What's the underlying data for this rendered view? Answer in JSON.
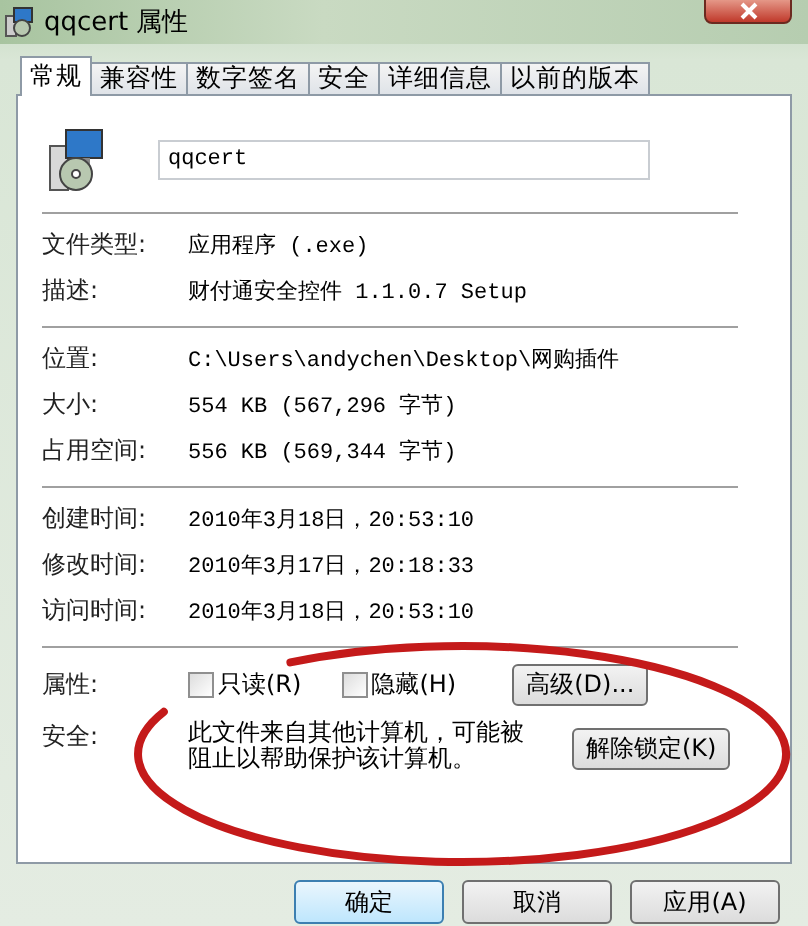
{
  "window": {
    "title": "qqcert 属性"
  },
  "tabs": [
    {
      "label": "常规",
      "selected": true
    },
    {
      "label": "兼容性",
      "selected": false
    },
    {
      "label": "数字签名",
      "selected": false
    },
    {
      "label": "安全",
      "selected": false
    },
    {
      "label": "详细信息",
      "selected": false
    },
    {
      "label": "以前的版本",
      "selected": false
    }
  ],
  "file_name": {
    "value": "qqcert"
  },
  "sections": [
    [
      {
        "label": "文件类型:",
        "value": "应用程序 (.exe)"
      },
      {
        "label": "描述:",
        "value": "财付通安全控件 1.1.0.7 Setup"
      }
    ],
    [
      {
        "label": "位置:",
        "value": "C:\\Users\\andychen\\Desktop\\网购插件"
      },
      {
        "label": "大小:",
        "value": "554 KB (567,296 字节)"
      },
      {
        "label": "占用空间:",
        "value": "556 KB (569,344 字节)"
      }
    ],
    [
      {
        "label": "创建时间:",
        "value": "2010年3月18日，20:53:10"
      },
      {
        "label": "修改时间:",
        "value": "2010年3月17日，20:18:33"
      },
      {
        "label": "访问时间:",
        "value": "2010年3月18日，20:53:10"
      }
    ]
  ],
  "attributes": {
    "label": "属性:",
    "checkboxes": [
      {
        "label": "只读(R)",
        "checked": false
      },
      {
        "label": "隐藏(H)",
        "checked": false
      }
    ],
    "button": "高级(D)..."
  },
  "security": {
    "label": "安全:",
    "text": "此文件来自其他计算机，可能被阻止以帮助保护该计算机。",
    "button": "解除锁定(K)"
  },
  "buttons": [
    {
      "label": "确定",
      "default": true
    },
    {
      "label": "取消",
      "default": false
    },
    {
      "label": "应用(A)",
      "default": false
    }
  ]
}
